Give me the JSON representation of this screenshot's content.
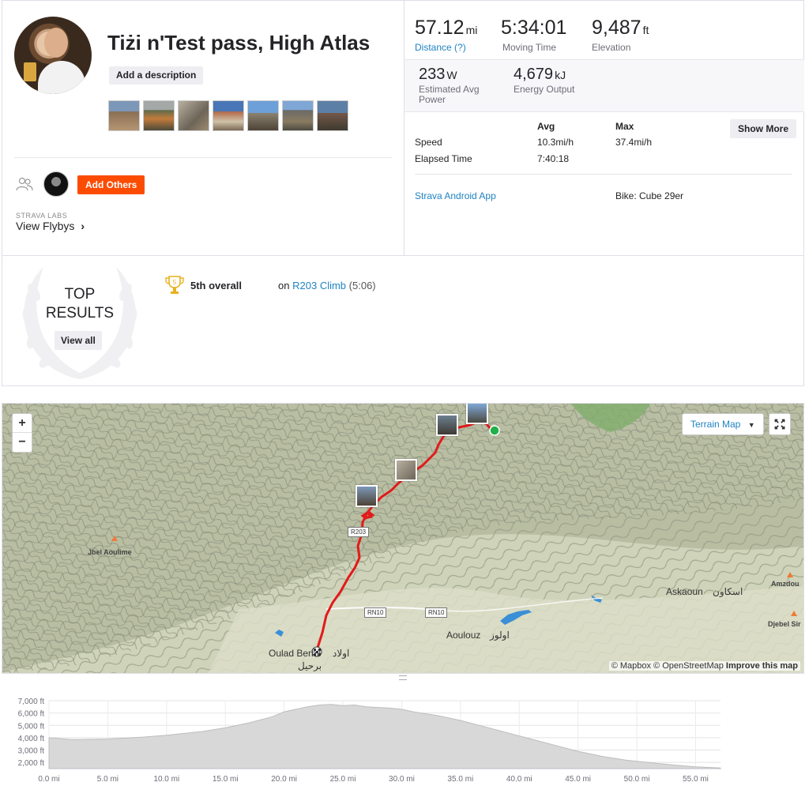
{
  "activity": {
    "title": "Tiżi n'Test pass, High Atlas",
    "add_description": "Add a description",
    "photos": [
      "photo-1",
      "photo-2",
      "photo-3",
      "photo-4",
      "photo-5",
      "photo-6",
      "photo-7"
    ],
    "add_others": "Add Others",
    "labs": "STRAVA LABS",
    "view_flybys": "View Flybys"
  },
  "stats": {
    "distance": {
      "value": "57.12",
      "unit": "mi",
      "label": "Distance (?)"
    },
    "moving_time": {
      "value": "5:34:01",
      "label": "Moving Time"
    },
    "elevation": {
      "value": "9,487",
      "unit": "ft",
      "label": "Elevation"
    },
    "power": {
      "value": "233",
      "unit": "W",
      "label_1": "Estimated Avg",
      "label_2": "Power"
    },
    "energy": {
      "value": "4,679",
      "unit": "kJ",
      "label": "Energy Output"
    },
    "table": {
      "col_avg": "Avg",
      "col_max": "Max",
      "speed_label": "Speed",
      "speed_avg": "10.3mi/h",
      "speed_max": "37.4mi/h",
      "elapsed_label": "Elapsed Time",
      "elapsed_avg": "7:40:18"
    },
    "show_more": "Show More",
    "device": "Strava Android App",
    "bike": "Bike: Cube 29er"
  },
  "results": {
    "top_1": "TOP",
    "top_2": "RESULTS",
    "view_all": "View all",
    "trophy_rank": "5",
    "rank_text": "5th overall",
    "on_text": "on",
    "segment": "R203 Climb",
    "segment_time": "(5:06)"
  },
  "map": {
    "zoom_in": "+",
    "zoom_out": "−",
    "map_type": "Terrain Map",
    "places": {
      "jbel_aoulime": "Jbel Aoulime",
      "askaoun": "Askaoun",
      "askaoun_ar": "اسكاون",
      "amzdou": "Amzdou",
      "djebel_sir": "Djebel Sir",
      "aoulouz": "Aoulouz",
      "aoulouz_ar": "اولوز",
      "oulad_berhil": "Oulad Berhil",
      "oulad_ar_1": "اولاد",
      "oulad_ar_2": "برحيل"
    },
    "roads": [
      "RN10",
      "RN10",
      "R203"
    ],
    "attribution_1": "© Mapbox © OpenStreetMap",
    "attribution_2": "Improve this map"
  },
  "elevation_profile": {
    "y_ticks": [
      "7,000 ft",
      "6,000 ft",
      "5,000 ft",
      "4,000 ft",
      "3,000 ft",
      "2,000 ft"
    ],
    "x_ticks": [
      "0.0 mi",
      "5.0 mi",
      "10.0 mi",
      "15.0 mi",
      "20.0 mi",
      "25.0 mi",
      "30.0 mi",
      "35.0 mi",
      "40.0 mi",
      "45.0 mi",
      "50.0 mi",
      "55.0 mi"
    ]
  },
  "chart_data": {
    "type": "area",
    "x": [
      0,
      2,
      5,
      8,
      10,
      13,
      15,
      17,
      19,
      20,
      21,
      22,
      23,
      24,
      25,
      26,
      27,
      28,
      29,
      30,
      31,
      33,
      35,
      37,
      39,
      41,
      43,
      45,
      47,
      49,
      51,
      53,
      55,
      57.12
    ],
    "y": [
      4000,
      3850,
      3900,
      4050,
      4200,
      4500,
      4800,
      5200,
      5700,
      6100,
      6300,
      6500,
      6650,
      6700,
      6600,
      6650,
      6500,
      6450,
      6400,
      6300,
      6100,
      5800,
      5400,
      4900,
      4400,
      3900,
      3400,
      2900,
      2500,
      2200,
      2000,
      1800,
      1650,
      1550
    ],
    "xlabel": "",
    "ylabel": "",
    "xlim": [
      0,
      57.12
    ],
    "ylim": [
      1500,
      7000
    ],
    "grid": true,
    "colors": {
      "fill": "#d8d8d8",
      "stroke": "#bdbdbd"
    }
  },
  "colors": {
    "accent": "#fc4c02",
    "link": "#1f83c3",
    "route": "#e21a1a",
    "start": "#22b04a"
  }
}
